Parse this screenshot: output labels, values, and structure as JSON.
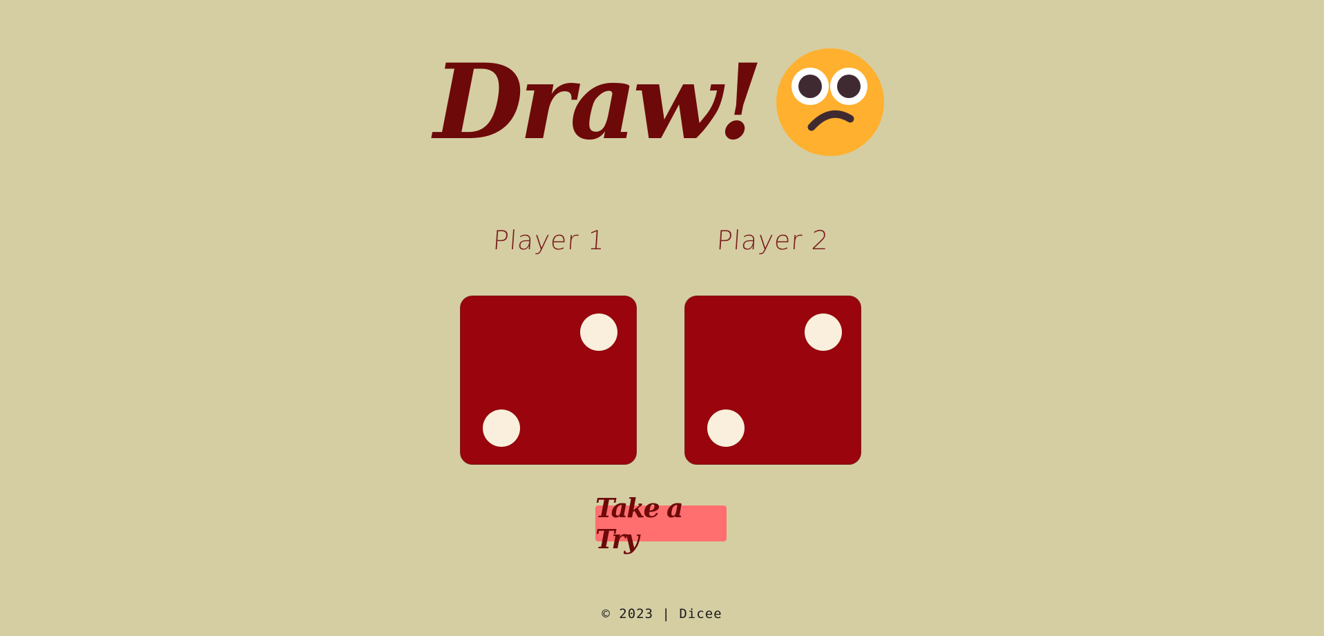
{
  "header": {
    "result_text": "Draw!",
    "result_emoji": "worried-face-icon"
  },
  "players": [
    {
      "label": "Player 1",
      "die_value": 2
    },
    {
      "label": "Player 2",
      "die_value": 2
    }
  ],
  "action": {
    "button_label": "Take a Try"
  },
  "footer": {
    "text": "© 2023 | Dicee"
  },
  "colors": {
    "background": "#d5cea3",
    "title": "#6d0909",
    "die_face": "#9a040c",
    "pip": "#faefdc",
    "button": "#ff6f6f",
    "emoji_face": "#ffb02e"
  }
}
